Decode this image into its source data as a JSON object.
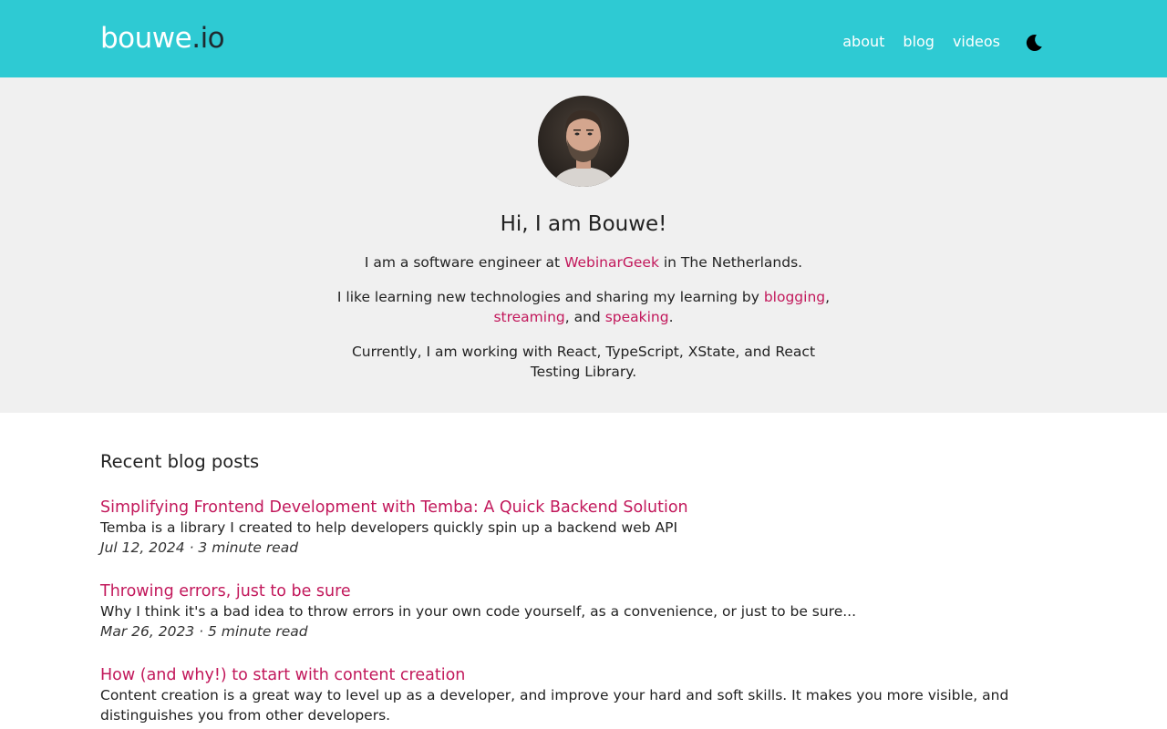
{
  "header": {
    "logo_name": "bouwe",
    "logo_tld": ".io",
    "nav": [
      "about",
      "blog",
      "videos"
    ],
    "theme_icon": "moon-icon"
  },
  "hero": {
    "avatar_icon": "profile-photo",
    "heading": "Hi, I am Bouwe!",
    "line1_pre": "I am a software engineer at ",
    "line1_link": "WebinarGeek",
    "line1_post": " in The Netherlands.",
    "line2_pre": "I like learning new technologies and sharing my learning by ",
    "line2_link1": "blogging",
    "line2_sep1": ", ",
    "line2_link2": "streaming",
    "line2_sep2": ", and ",
    "line2_link3": "speaking",
    "line2_end": ".",
    "line3": "Currently, I am working with React, TypeScript, XState, and React Testing Library."
  },
  "posts": {
    "heading": "Recent blog posts",
    "items": [
      {
        "title": "Simplifying Frontend Development with Temba: A Quick Backend Solution",
        "description": "Temba is a library I created to help developers quickly spin up a backend web API",
        "meta": "Jul 12, 2024 · 3 minute read"
      },
      {
        "title": "Throwing errors, just to be sure",
        "description": "Why I think it's a bad idea to throw errors in your own code yourself, as a convenience, or just to be sure...",
        "meta": "Mar 26, 2023 · 5 minute read"
      },
      {
        "title": "How (and why!) to start with content creation",
        "description": "Content creation is a great way to level up as a developer, and improve your hard and soft skills. It makes you more visible, and distinguishes you from other developers.",
        "meta": ""
      }
    ]
  },
  "colors": {
    "header_bg": "#2ecad3",
    "hero_bg": "#f0f0f0",
    "link": "#c2185b"
  }
}
